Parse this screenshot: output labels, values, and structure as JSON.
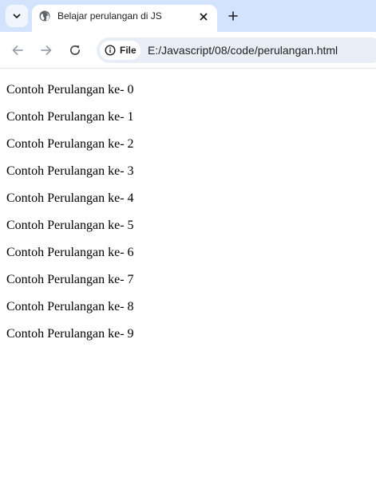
{
  "browser": {
    "tab": {
      "title": "Belajar perulangan di JS"
    },
    "omnibox": {
      "chip_label": "File",
      "url": "E:/Javascript/08/code/perulangan.html"
    }
  },
  "page": {
    "lines": [
      "Contoh Perulangan ke- 0",
      "Contoh Perulangan ke- 1",
      "Contoh Perulangan ke- 2",
      "Contoh Perulangan ke- 3",
      "Contoh Perulangan ke- 4",
      "Contoh Perulangan ke- 5",
      "Contoh Perulangan ke- 6",
      "Contoh Perulangan ke- 7",
      "Contoh Perulangan ke- 8",
      "Contoh Perulangan ke- 9"
    ]
  },
  "icons": {
    "tab_search": "chevron-down-icon",
    "favicon": "globe-icon",
    "close": "close-icon",
    "new_tab": "plus-icon",
    "back": "arrow-left-icon",
    "forward": "arrow-right-icon",
    "reload": "reload-icon",
    "site_info": "info-icon"
  },
  "colors": {
    "tabstrip": "#d3e3fd",
    "omnibox": "#e9eef6",
    "page_background": "#ffffff",
    "text": "#000000"
  }
}
